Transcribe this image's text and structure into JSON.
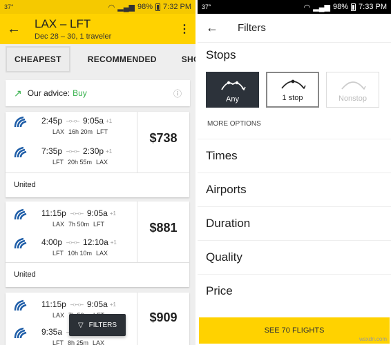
{
  "left": {
    "status": {
      "temp": "37°",
      "battery": "98%",
      "time": "7:32 PM"
    },
    "header": {
      "route": "LAX – LFT",
      "subtitle": "Dec 28 – 30, 1 traveler"
    },
    "tabs": [
      "CHEAPEST",
      "RECOMMENDED",
      "SHORTEST"
    ],
    "advice": {
      "label": "Our advice:",
      "value": "Buy"
    },
    "results": [
      {
        "legs": [
          {
            "dep": "2:45p",
            "arr": "9:05a",
            "plus": "+1",
            "from": "LAX",
            "dur": "16h 20m",
            "to": "LFT"
          },
          {
            "dep": "7:35p",
            "arr": "2:30p",
            "plus": "+1",
            "from": "LFT",
            "dur": "20h 55m",
            "to": "LAX"
          }
        ],
        "price": "$738",
        "airline": "United"
      },
      {
        "legs": [
          {
            "dep": "11:15p",
            "arr": "9:05a",
            "plus": "+1",
            "from": "LAX",
            "dur": "7h 50m",
            "to": "LFT"
          },
          {
            "dep": "4:00p",
            "arr": "12:10a",
            "plus": "+1",
            "from": "LFT",
            "dur": "10h 10m",
            "to": "LAX"
          }
        ],
        "price": "$881",
        "airline": "United"
      },
      {
        "legs": [
          {
            "dep": "11:15p",
            "arr": "9:05a",
            "plus": "+1",
            "from": "LAX",
            "dur": "7h 50m",
            "to": "LFT"
          },
          {
            "dep": "9:35a",
            "arr": "",
            "plus": "",
            "from": "LFT",
            "dur": "8h 25m",
            "to": "LAX"
          }
        ],
        "price": "$909",
        "airline": ""
      }
    ],
    "filters_button": "FILTERS",
    "brand_color": "#ffd200"
  },
  "right": {
    "status": {
      "temp": "37°",
      "battery": "98%",
      "time": "7:33 PM"
    },
    "title": "Filters",
    "stops_title": "Stops",
    "stop_options": [
      "Any",
      "1 stop",
      "Nonstop"
    ],
    "more_options": "MORE OPTIONS",
    "sections": [
      "Times",
      "Airports",
      "Duration",
      "Quality",
      "Price"
    ],
    "cta": "SEE 70 FLIGHTS"
  },
  "watermark": "wsxdn.com"
}
